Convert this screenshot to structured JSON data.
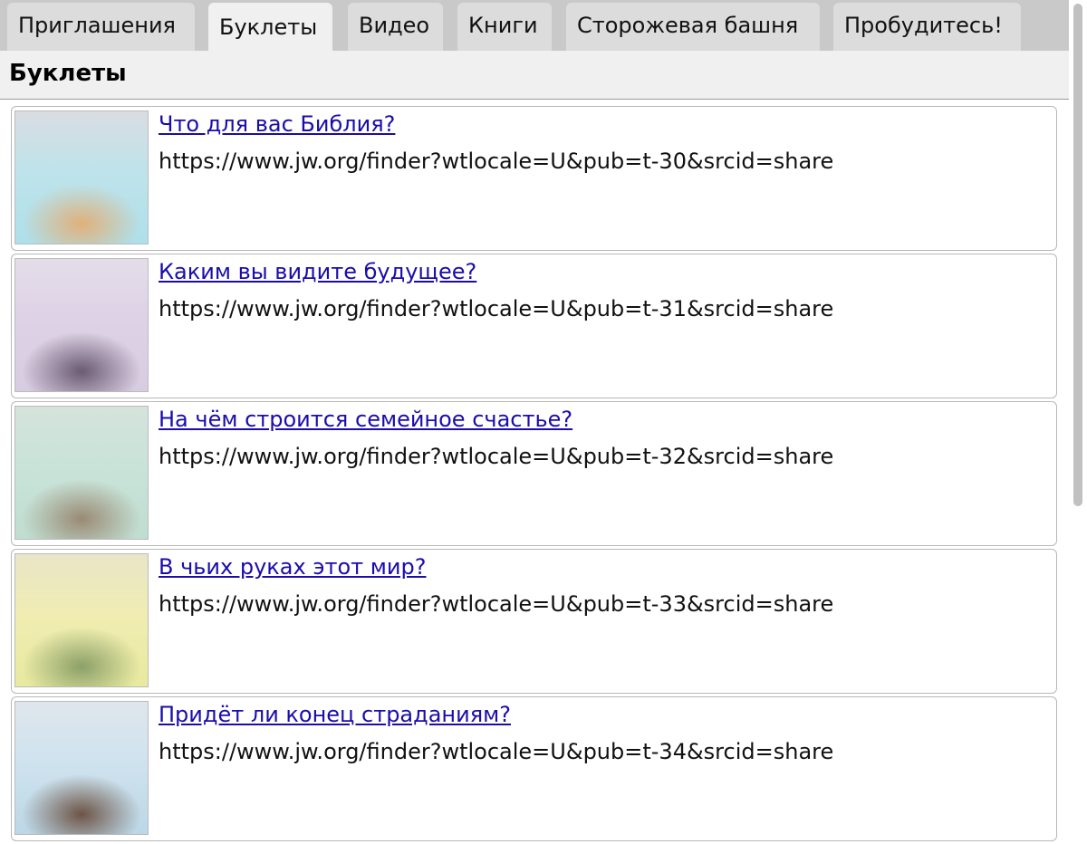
{
  "tabs": [
    {
      "label": "Приглашения",
      "active": false
    },
    {
      "label": "Буклеты",
      "active": true
    },
    {
      "label": "Видео",
      "active": false
    },
    {
      "label": "Книги",
      "active": false
    },
    {
      "label": "Сторожевая башня",
      "active": false
    },
    {
      "label": "Пробудитесь!",
      "active": false
    }
  ],
  "header": {
    "title": "Буклеты"
  },
  "items": [
    {
      "title": "Что для вас Библия?",
      "url": "https://www.jw.org/finder?wtlocale=U&pub=t-30&srcid=share",
      "thumb_colors": [
        "#d9dde2",
        "#bfe3ea",
        "#aee0ea",
        "#e0b07a"
      ]
    },
    {
      "title": "Каким вы видите будущее?",
      "url": "https://www.jw.org/finder?wtlocale=U&pub=t-31&srcid=share",
      "thumb_colors": [
        "#e4dde9",
        "#ddd2e6",
        "#d8cce1",
        "#6a5a73"
      ]
    },
    {
      "title": "На чём строится семейное счастье?",
      "url": "https://www.jw.org/finder?wtlocale=U&pub=t-32&srcid=share",
      "thumb_colors": [
        "#d5e3dc",
        "#c9e3d8",
        "#c0ddd0",
        "#9a8a74"
      ]
    },
    {
      "title": "В чьих руках этот мир?",
      "url": "https://www.jw.org/finder?wtlocale=U&pub=t-33&srcid=share",
      "thumb_colors": [
        "#e8e6c8",
        "#f0ecb3",
        "#e8ea9f",
        "#8ca068"
      ]
    },
    {
      "title": "Придёт ли конец страданиям?",
      "url": "https://www.jw.org/finder?wtlocale=U&pub=t-34&srcid=share",
      "thumb_colors": [
        "#dfe6ec",
        "#cfe3ee",
        "#bcd7e6",
        "#6d5446"
      ]
    }
  ]
}
